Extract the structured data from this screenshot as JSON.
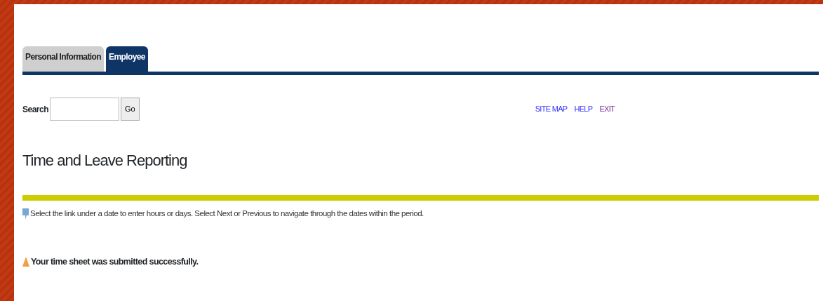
{
  "tabs": [
    {
      "label": "Personal Information",
      "selected": false
    },
    {
      "label": "Employee",
      "selected": true
    }
  ],
  "search": {
    "label": "Search",
    "button": "Go"
  },
  "links": [
    {
      "label": "SITE MAP",
      "visited": false
    },
    {
      "label": "HELP",
      "visited": false
    },
    {
      "label": "EXIT",
      "visited": true
    }
  ],
  "title": "Time and Leave Reporting",
  "info": "Select the link under a date to enter hours or days. Select Next or Previous to navigate through the dates within the period.",
  "message": "Your time sheet was submitted successfully."
}
